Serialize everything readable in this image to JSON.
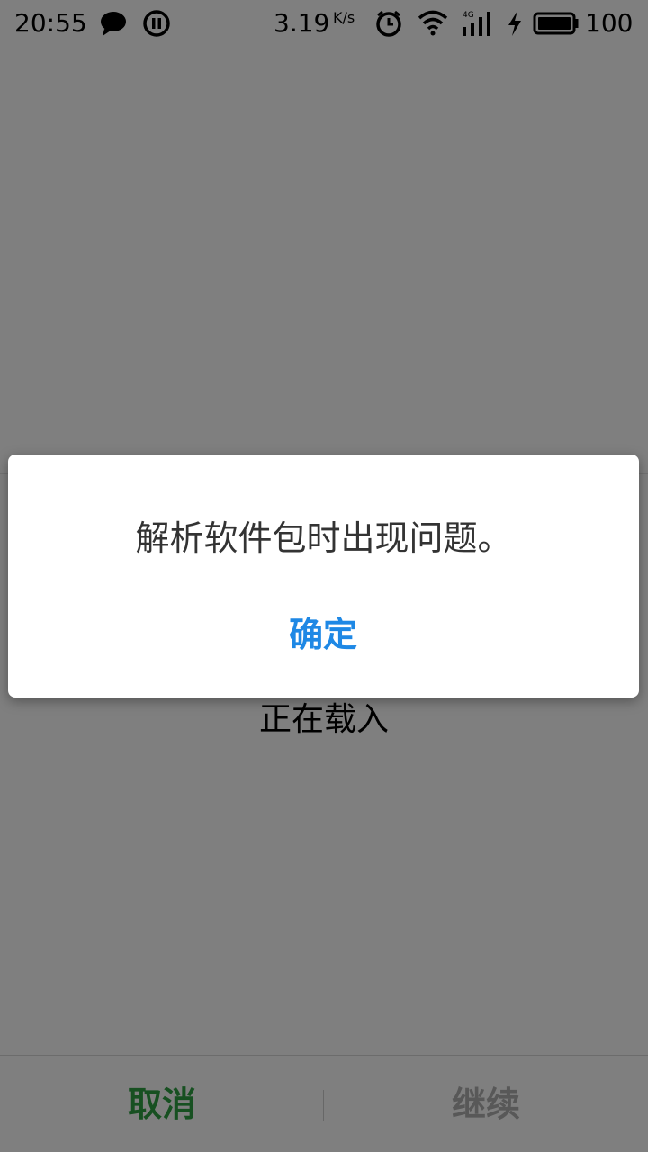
{
  "status_bar": {
    "time": "20:55",
    "net_speed": "3.19",
    "net_speed_unit": "K/s",
    "network_type": "4G",
    "battery_level": "100",
    "icons": [
      "message-icon",
      "pause-icon",
      "alarm-icon",
      "wifi-icon",
      "signal-icon",
      "charging-icon",
      "battery-icon"
    ]
  },
  "page": {
    "loading_text": "正在载入",
    "cancel_label": "取消",
    "continue_label": "继续"
  },
  "dialog": {
    "message": "解析软件包时出现问题。",
    "ok_label": "确定"
  },
  "colors": {
    "cancel": "#2ea043",
    "continue_disabled": "#b0b0b0",
    "dialog_button": "#1e88e5"
  }
}
